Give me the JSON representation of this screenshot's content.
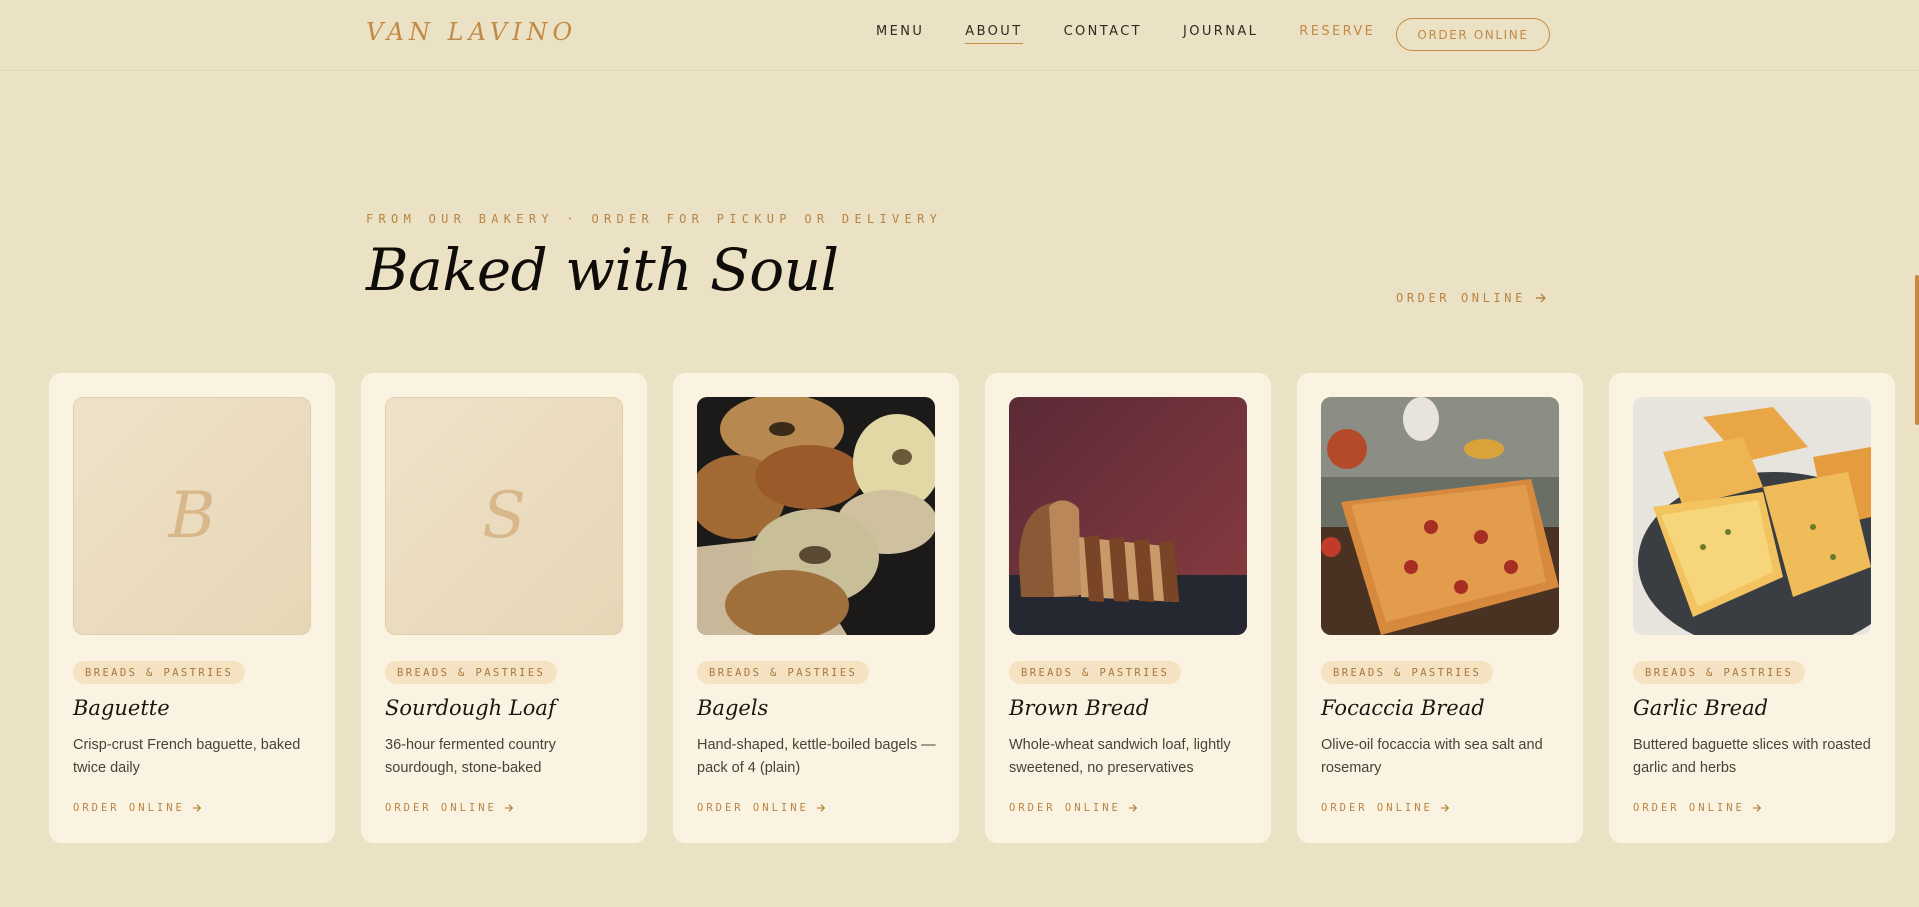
{
  "brand": {
    "logo": "VAN LAVINO"
  },
  "nav": {
    "items": [
      {
        "label": "MENU"
      },
      {
        "label": "ABOUT"
      },
      {
        "label": "CONTACT"
      },
      {
        "label": "JOURNAL"
      },
      {
        "label": "RESERVE"
      }
    ],
    "cta": "ORDER ONLINE"
  },
  "hero": {
    "eyebrow": "FROM OUR BAKERY · ORDER FOR PICKUP OR DELIVERY",
    "title": "Baked with Soul",
    "link": "ORDER ONLINE"
  },
  "products": [
    {
      "category": "BREADS & PASTRIES",
      "name": "Baguette",
      "description": "Crisp-crust French baguette, baked twice daily",
      "link": "ORDER ONLINE",
      "placeholder_letter": "B"
    },
    {
      "category": "BREADS & PASTRIES",
      "name": "Sourdough Loaf",
      "description": "36-hour fermented country sourdough, stone-baked",
      "link": "ORDER ONLINE",
      "placeholder_letter": "S"
    },
    {
      "category": "BREADS & PASTRIES",
      "name": "Bagels",
      "description": "Hand-shaped, kettle-boiled bagels — pack of 4 (plain)",
      "link": "ORDER ONLINE",
      "image": "bagels-photo"
    },
    {
      "category": "BREADS & PASTRIES",
      "name": "Brown Bread",
      "description": "Whole-wheat sandwich loaf, lightly sweetened, no preservatives",
      "link": "ORDER ONLINE",
      "image": "brown-bread-photo"
    },
    {
      "category": "BREADS & PASTRIES",
      "name": "Focaccia Bread",
      "description": "Olive-oil focaccia with sea salt and rosemary",
      "link": "ORDER ONLINE",
      "image": "focaccia-photo"
    },
    {
      "category": "BREADS & PASTRIES",
      "name": "Garlic Bread",
      "description": "Buttered baguette slices with roasted garlic and herbs",
      "link": "ORDER ONLINE",
      "image": "garlic-bread-photo"
    }
  ],
  "colors": {
    "background": "#ebe2c5",
    "card": "#fbf3e1",
    "accent": "#c28a47",
    "badge": "#f4e2c2"
  }
}
